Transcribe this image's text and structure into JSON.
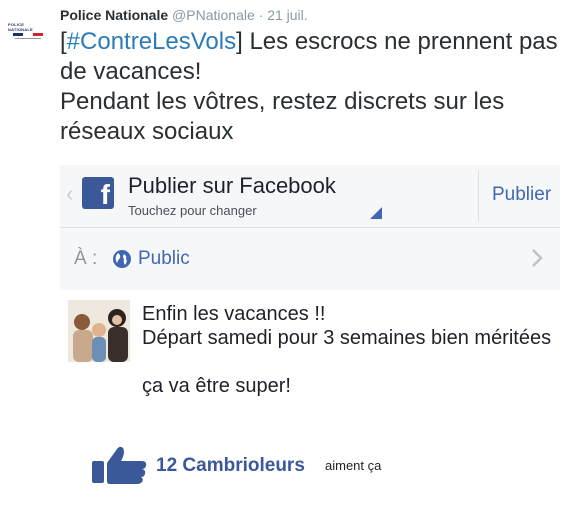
{
  "tweet": {
    "author_name": "Police Nationale",
    "handle": "@PNationale",
    "separator": "·",
    "time": "21 juil.",
    "avatar_text": "POLICE NATIONALE",
    "text_open_bracket": "[",
    "hashtag": "#ContreLesVols",
    "text_rest": "] Les escrocs ne prennent pas de vacances!",
    "text_line2": "Pendant les vôtres, restez discrets sur les réseaux sociaux"
  },
  "facebook": {
    "title": "Publier sur Facebook",
    "subtitle": "Touchez pour changer",
    "publish_label": "Publier",
    "logo_letter": "f",
    "back_glyph": "‹",
    "audience_label": "À :",
    "audience_value": "Public",
    "post": {
      "line1": "Enfin les vacances !!",
      "line2": "Départ samedi pour 3 semaines bien méritées",
      "line3": "ça va être super!"
    },
    "likes_count": "12 Cambrioleurs",
    "likes_suffix": "aiment ça"
  },
  "colors": {
    "facebook_blue": "#3b5998",
    "link_blue": "#4267b2",
    "hashtag_blue": "#2b7bb9"
  }
}
